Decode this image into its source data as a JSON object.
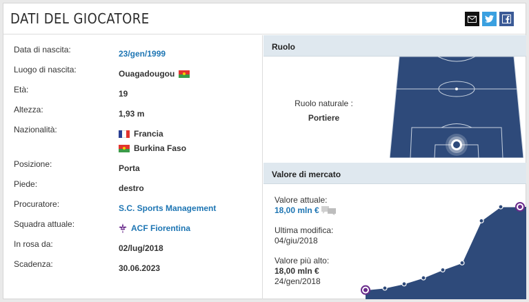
{
  "header": {
    "title": "DATI DEL GIOCATORE"
  },
  "share": {
    "mail_icon": "envelope-icon",
    "twitter_icon": "twitter-icon",
    "facebook_icon": "facebook-icon"
  },
  "details": [
    {
      "label": "Data di nascita:",
      "value": "23/gen/1999",
      "link": true
    },
    {
      "label": "Luogo di nascita:",
      "value": "Ouagadougou",
      "flag": "burkina-faso"
    },
    {
      "label": "Età:",
      "value": "19"
    },
    {
      "label": "Altezza:",
      "value": "1,93 m"
    },
    {
      "label": "Nazionalità:",
      "value": "Francia",
      "flag": "france",
      "value2": "Burkina Faso",
      "flag2": "burkina-faso"
    },
    {
      "label": "Posizione:",
      "value": "Porta"
    },
    {
      "label": "Piede:",
      "value": "destro"
    },
    {
      "label": "Procuratore:",
      "value": "S.C. Sports Management",
      "link": true
    },
    {
      "label": "Squadra attuale:",
      "value": "ACF Fiorentina",
      "link": true,
      "icon": "fiorentina-lily-icon"
    },
    {
      "label": "In rosa da:",
      "value": "02/lug/2018"
    },
    {
      "label": "Scadenza:",
      "value": "30.06.2023"
    }
  ],
  "ruolo": {
    "title": "Ruolo",
    "natural_label": "Ruolo naturale :",
    "natural_value": "Portiere"
  },
  "market": {
    "title": "Valore di mercato",
    "current_label": "Valore attuale:",
    "current_value": "18,00 mln €",
    "modified_label": "Ultima modifica:",
    "modified_value": "04/giu/2018",
    "highest_label": "Valore più alto:",
    "highest_value": "18,00 mln €",
    "highest_date": "24/gen/2018"
  },
  "chart_data": {
    "type": "area",
    "series": [
      {
        "values": [
          0.2,
          0.6,
          1.5,
          2.8,
          4.5,
          6.0,
          15.0,
          18.0,
          18.0
        ]
      }
    ],
    "ylim": [
      0,
      18
    ],
    "color": "#2e4a7a"
  },
  "colors": {
    "accent": "#1d75b3",
    "section_bg": "#dfe8ef",
    "pitch": "#2e4a7a"
  }
}
